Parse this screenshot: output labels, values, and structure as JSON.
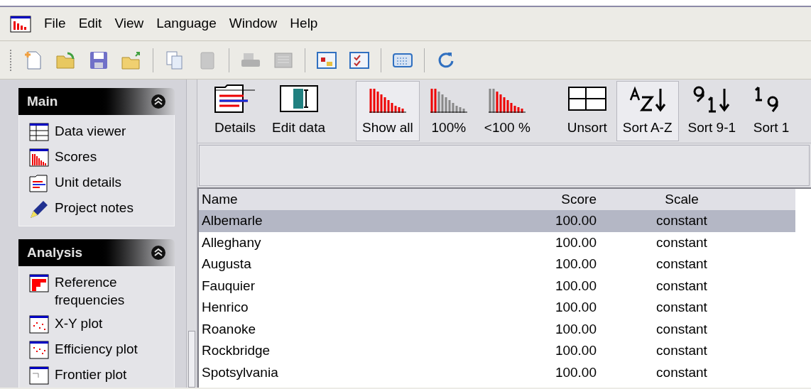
{
  "menu": [
    "File",
    "Edit",
    "View",
    "Language",
    "Window",
    "Help"
  ],
  "sidebar": [
    {
      "title": "Main",
      "items": [
        "Data viewer",
        "Scores",
        "Unit details",
        "Project notes"
      ]
    },
    {
      "title": "Analysis",
      "items": [
        "Reference frequencies",
        "X-Y plot",
        "Efficiency plot",
        "Frontier plot"
      ]
    }
  ],
  "view_toolbar": [
    {
      "label": "Details",
      "selected": false
    },
    {
      "label": "Edit data",
      "selected": false
    },
    {
      "label": "Show all",
      "selected": true
    },
    {
      "label": "100%",
      "selected": false
    },
    {
      "label": "<100 %",
      "selected": false
    },
    {
      "label": "Unsort",
      "selected": false
    },
    {
      "label": "Sort A-Z",
      "selected": true
    },
    {
      "label": "Sort 9-1",
      "selected": false
    },
    {
      "label": "Sort 1",
      "selected": false
    }
  ],
  "table": {
    "columns": [
      "Name",
      "Score",
      "Scale"
    ],
    "rows": [
      {
        "cells": [
          "Albemarle",
          "100.00",
          "constant"
        ],
        "selected": true
      },
      {
        "cells": [
          "Alleghany",
          "100.00",
          "constant"
        ],
        "selected": false
      },
      {
        "cells": [
          "Augusta",
          "100.00",
          "constant"
        ],
        "selected": false
      },
      {
        "cells": [
          "Fauquier",
          "100.00",
          "constant"
        ],
        "selected": false
      },
      {
        "cells": [
          "Henrico",
          "100.00",
          "constant"
        ],
        "selected": false
      },
      {
        "cells": [
          "Roanoke",
          "100.00",
          "constant"
        ],
        "selected": false
      },
      {
        "cells": [
          "Rockbridge",
          "100.00",
          "constant"
        ],
        "selected": false
      },
      {
        "cells": [
          "Spotsylvania",
          "100.00",
          "constant"
        ],
        "selected": false
      }
    ]
  }
}
